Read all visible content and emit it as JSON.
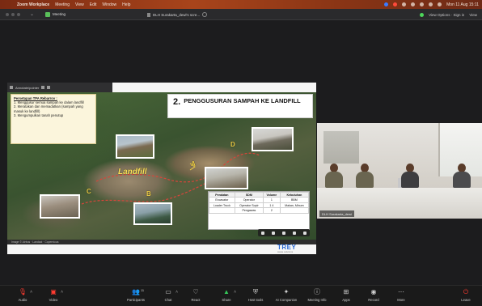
{
  "menubar": {
    "apple": "",
    "items": [
      "Zoom Workplace",
      "Meeting",
      "View",
      "Edit",
      "Window",
      "Help"
    ],
    "clock": "Mon 11 Aug 15:11"
  },
  "window": {
    "meeting_label": "Meeting",
    "tab_label": "DLH Surakarta_dewi's scre...",
    "right_label": "View Options · Sign in",
    "right_view": "View"
  },
  "slide": {
    "toolbar_label": "Annotate/pointer",
    "number": "2.",
    "title": "PENGGUSURAN SAMPAH KE LANDFILL",
    "note_title": "Persetapan TPA Rebarrov :",
    "note_items": [
      "1.  Menggusur semua sampah ke dalam landfill",
      "2.  Meratakan dan memadatkan (sampah yang masuk ke landfill)",
      "3.  Mengumpulkan tanah penutup"
    ],
    "labels": {
      "landfill": "Landfill",
      "A": "A",
      "B": "B",
      "C": "C",
      "D": "D"
    },
    "table": {
      "headers": [
        "Peralatan",
        "SDM",
        "Volume",
        "Kebutuhan"
      ],
      "rows": [
        [
          "Excavator",
          "Operator",
          "1",
          "BBM"
        ],
        [
          "Loader Truck",
          "Operator Sopir",
          "1 4",
          "Makan, Minum"
        ],
        [
          "",
          "Pengawas",
          "2",
          ""
        ]
      ]
    },
    "bottom_caption": "Image © Airbus · Landsat · Copernicus",
    "brand": "TREY",
    "brand_sub": "waste solutions"
  },
  "camera": {
    "name_badge": "DLH Surakarta_dewi"
  },
  "controls": [
    {
      "label": "Audio",
      "icon": "mic-muted-icon",
      "glyph": "🎤"
    },
    {
      "label": "Video",
      "icon": "video-muted-icon",
      "glyph": "📷"
    },
    {
      "label": "Participants",
      "icon": "participants-icon",
      "glyph": "👥",
      "badge": "11"
    },
    {
      "label": "Chat",
      "icon": "chat-icon",
      "glyph": "💬"
    },
    {
      "label": "React",
      "icon": "react-icon",
      "glyph": "♡"
    },
    {
      "label": "Share",
      "icon": "share-icon",
      "glyph": "⬆"
    },
    {
      "label": "Host tools",
      "icon": "host-tools-icon",
      "glyph": "⚙"
    },
    {
      "label": "AI Companion",
      "icon": "ai-companion-icon",
      "glyph": "✦"
    },
    {
      "label": "Meeting Info",
      "icon": "info-icon",
      "glyph": "ⓘ"
    },
    {
      "label": "Apps",
      "icon": "apps-icon",
      "glyph": "⊞"
    },
    {
      "label": "Record",
      "icon": "record-icon",
      "glyph": "◉"
    },
    {
      "label": "More",
      "icon": "more-icon",
      "glyph": "⋯"
    },
    {
      "label": "Leave",
      "icon": "leave-icon",
      "glyph": "⏻"
    }
  ]
}
